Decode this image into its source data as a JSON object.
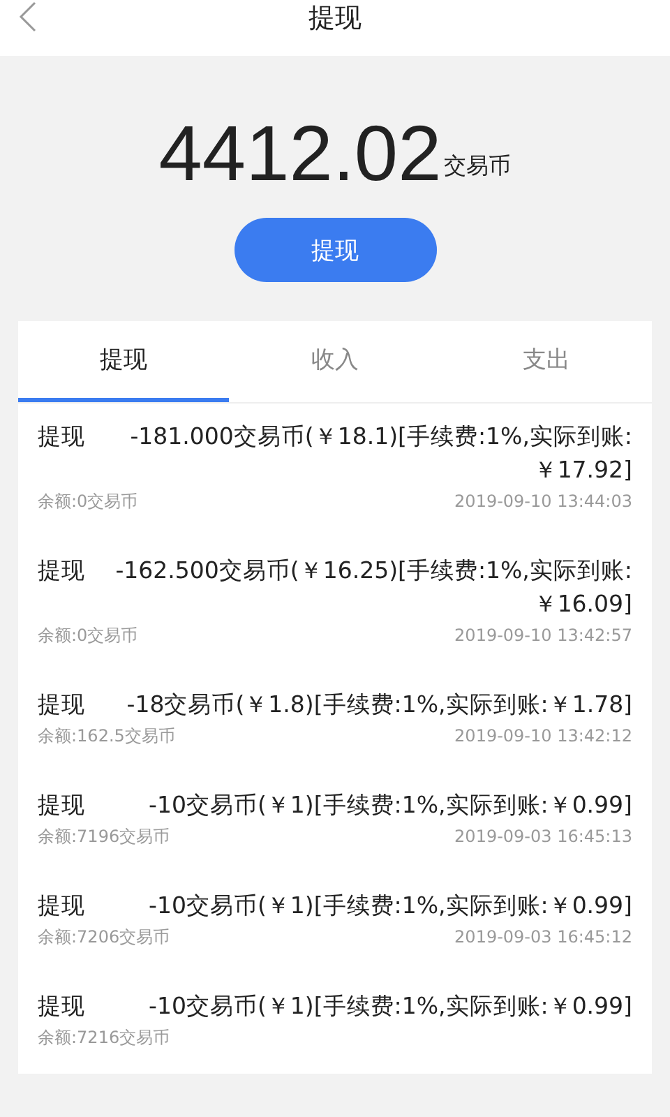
{
  "header": {
    "title": "提现"
  },
  "balance": {
    "amount": "4412.02",
    "unit": "交易币"
  },
  "withdraw_button": {
    "label": "提现"
  },
  "tabs": [
    {
      "label": "提现",
      "selected": true
    },
    {
      "label": "收入",
      "selected": false
    },
    {
      "label": "支出",
      "selected": false
    }
  ],
  "records": [
    {
      "type": "提现",
      "detail": "-181.000交易币(￥18.1)[手续费:1%,实际到账:￥17.92]",
      "balance": "余额:0交易币",
      "time": "2019-09-10 13:44:03"
    },
    {
      "type": "提现",
      "detail": "-162.500交易币(￥16.25)[手续费:1%,实际到账:￥16.09]",
      "balance": "余额:0交易币",
      "time": "2019-09-10 13:42:57"
    },
    {
      "type": "提现",
      "detail": "-18交易币(￥1.8)[手续费:1%,实际到账:￥1.78]",
      "balance": "余额:162.5交易币",
      "time": "2019-09-10 13:42:12"
    },
    {
      "type": "提现",
      "detail": "-10交易币(￥1)[手续费:1%,实际到账:￥0.99]",
      "balance": "余额:7196交易币",
      "time": "2019-09-03 16:45:13"
    },
    {
      "type": "提现",
      "detail": "-10交易币(￥1)[手续费:1%,实际到账:￥0.99]",
      "balance": "余额:7206交易币",
      "time": "2019-09-03 16:45:12"
    },
    {
      "type": "提现",
      "detail": "-10交易币(￥1)[手续费:1%,实际到账:￥0.99]",
      "balance": "余额:7216交易币"
    }
  ]
}
